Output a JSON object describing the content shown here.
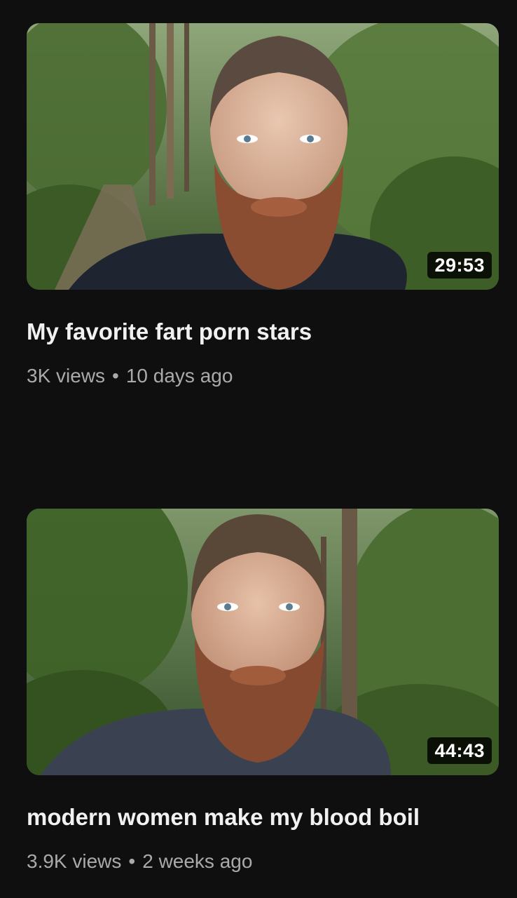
{
  "videos": [
    {
      "duration": "29:53",
      "title": "My favorite fart porn stars",
      "views": "3K views",
      "separator": "•",
      "age": "10 days ago"
    },
    {
      "duration": "44:43",
      "title": "modern women make my blood boil",
      "views": "3.9K views",
      "separator": "•",
      "age": "2 weeks ago"
    }
  ],
  "colors": {
    "background": "#0f0f0f",
    "title_text": "#f1f1f1",
    "meta_text": "#aaaaaa",
    "badge_background": "#000000"
  },
  "icons": [
    "video-thumbnail-image"
  ]
}
